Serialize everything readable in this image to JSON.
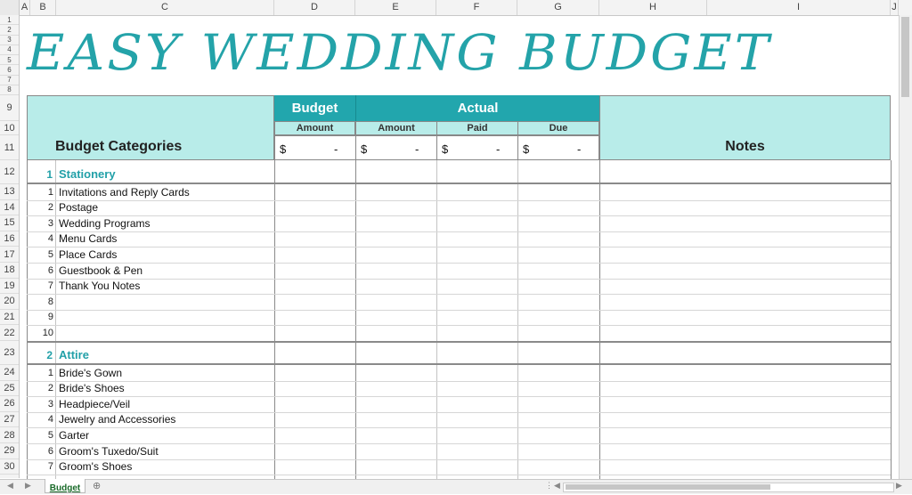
{
  "title": "EASY WEDDING BUDGET",
  "columns": [
    "A",
    "B",
    "C",
    "D",
    "E",
    "F",
    "G",
    "H",
    "I",
    "J"
  ],
  "rows": [
    "1",
    "2",
    "3",
    "4",
    "5",
    "6",
    "7",
    "8",
    "9",
    "10",
    "11",
    "12",
    "13",
    "14",
    "15",
    "16",
    "17",
    "18",
    "19",
    "20",
    "21",
    "22",
    "23",
    "24",
    "25",
    "26",
    "27",
    "28",
    "29",
    "30"
  ],
  "header": {
    "budget": "Budget",
    "actual": "Actual",
    "amount_budget": "Amount",
    "amount_actual": "Amount",
    "paid": "Paid",
    "due": "Due",
    "categories": "Budget Categories",
    "notes": "Notes",
    "dollar": "$",
    "dash": "-"
  },
  "sections": [
    {
      "num": "1",
      "name": "Stationery",
      "items": [
        {
          "n": "1",
          "label": "Invitations and Reply Cards"
        },
        {
          "n": "2",
          "label": "Postage"
        },
        {
          "n": "3",
          "label": "Wedding Programs"
        },
        {
          "n": "4",
          "label": "Menu Cards"
        },
        {
          "n": "5",
          "label": "Place Cards"
        },
        {
          "n": "6",
          "label": "Guestbook & Pen"
        },
        {
          "n": "7",
          "label": "Thank You Notes"
        },
        {
          "n": "8",
          "label": ""
        },
        {
          "n": "9",
          "label": ""
        },
        {
          "n": "10",
          "label": ""
        }
      ]
    },
    {
      "num": "2",
      "name": "Attire",
      "items": [
        {
          "n": "1",
          "label": "Bride's Gown"
        },
        {
          "n": "2",
          "label": "Bride's Shoes"
        },
        {
          "n": "3",
          "label": "Headpiece/Veil"
        },
        {
          "n": "4",
          "label": "Jewelry and Accessories"
        },
        {
          "n": "5",
          "label": "Garter"
        },
        {
          "n": "6",
          "label": "Groom's Tuxedo/Suit"
        },
        {
          "n": "7",
          "label": "Groom's Shoes"
        }
      ]
    }
  ],
  "sheet_tab": "Budget",
  "colors": {
    "teal": "#22a6ad",
    "light": "#b8ece9",
    "title": "#24a3a9"
  }
}
